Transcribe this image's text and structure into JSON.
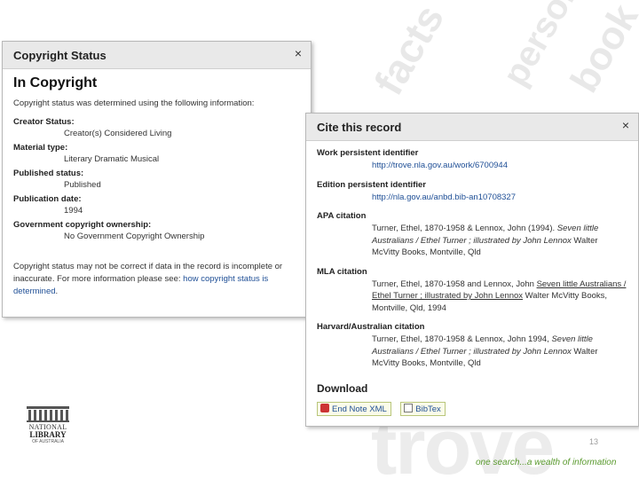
{
  "copyright_panel": {
    "title": "Copyright Status",
    "close_symbol": "×",
    "status_heading": "In Copyright",
    "intro": "Copyright status was determined using the following information:",
    "fields": [
      {
        "label": "Creator Status:",
        "value": "Creator(s) Considered Living"
      },
      {
        "label": "Material type:",
        "value": "Literary Dramatic Musical"
      },
      {
        "label": "Published status:",
        "value": "Published"
      },
      {
        "label": "Publication date:",
        "value": "1994"
      },
      {
        "label": "Government copyright ownership:",
        "value": "No Government Copyright Ownership"
      }
    ],
    "note_text": "Copyright status may not be correct if data in the record is incomplete or inaccurate. For more information please see: ",
    "note_link": "how copyright status is determined",
    "note_end": "."
  },
  "cite_panel": {
    "title": "Cite this record",
    "close_symbol": "×",
    "work_label": "Work persistent identifier",
    "work_value": "http://trove.nla.gov.au/work/6700944",
    "edition_label": "Edition persistent identifier",
    "edition_value": "http://nla.gov.au/anbd.bib-an10708327",
    "apa_label": "APA citation",
    "apa_part1": "Turner, Ethel, 1870-1958 & Lennox, John (1994). ",
    "apa_italic": "Seven little Australians / Ethel Turner ; illustrated by John Lennox",
    "apa_part2": " Walter McVitty Books, Montville, Qld",
    "mla_label": "MLA citation",
    "mla_part1": "Turner, Ethel, 1870-1958 and Lennox, John ",
    "mla_underline": "Seven little Australians / Ethel Turner ; illustrated by John Lennox",
    "mla_part2": " Walter McVitty Books, Montville, Qld, 1994",
    "harvard_label": "Harvard/Australian citation",
    "harvard_part1": "Turner, Ethel, 1870-1958 & Lennox, John 1994, ",
    "harvard_italic": "Seven little Australians / Ethel Turner ; illustrated by John Lennox",
    "harvard_part2": " Walter McVitty Books, Montville, Qld",
    "download_heading": "Download",
    "endnote_label": "End Note XML",
    "bibtex_label": "BibTex"
  },
  "slide": {
    "page_number": "13",
    "tagline": "one search...a wealth of information",
    "logo_line1": "NATIONAL",
    "logo_line2": "LIBRARY",
    "logo_line3": "OF AUSTRALIA"
  },
  "colors": {
    "accent_green": "#5a9a2e",
    "link_blue": "#1f4f96"
  }
}
